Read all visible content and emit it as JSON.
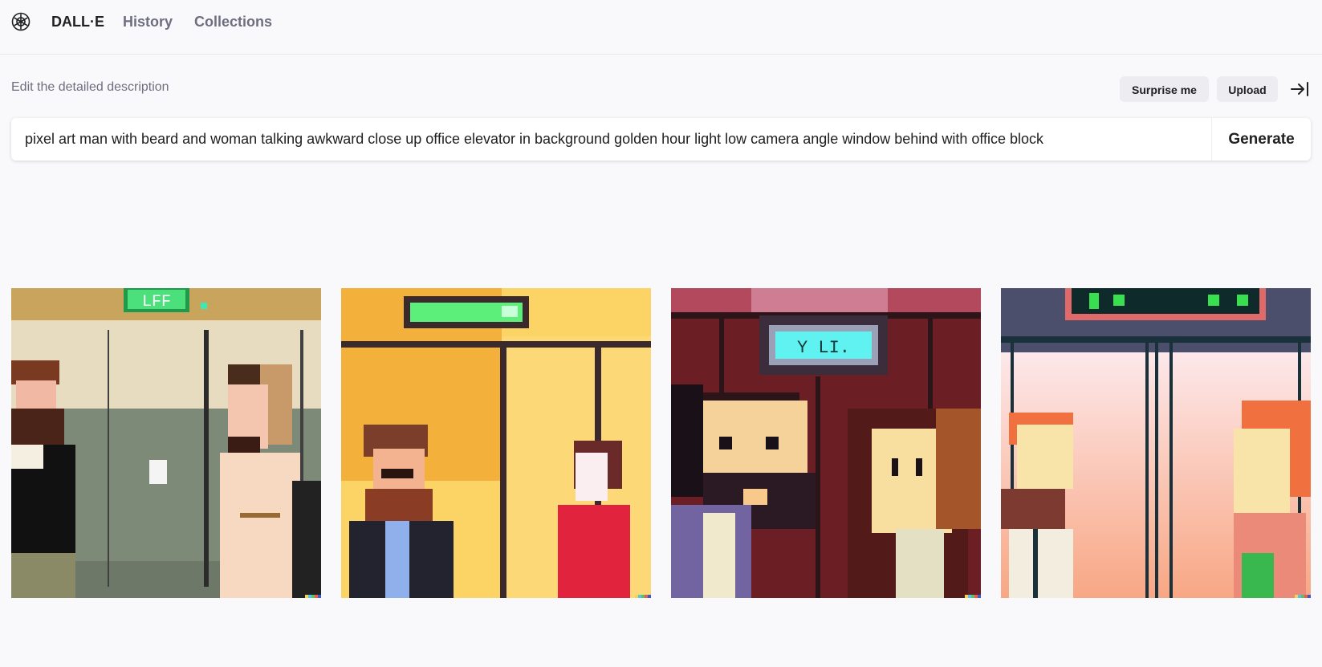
{
  "nav": {
    "brand": "DALL·E",
    "history": "History",
    "collections": "Collections"
  },
  "prompt": {
    "label": "Edit the detailed description",
    "value": "pixel art man with beard and woman talking awkward close up office elevator in background golden hour light low camera angle window behind with office block",
    "generate_label": "Generate"
  },
  "actions": {
    "surprise_label": "Surprise me",
    "upload_label": "Upload"
  },
  "icons": {
    "logo": "openai-logo-icon",
    "collapse": "arrow-right-to-line-icon"
  },
  "results": [
    {
      "scene": "realistic pixel elevator, green sign",
      "sign_text": "LFF"
    },
    {
      "scene": "yellow pixel elevator, green display"
    },
    {
      "scene": "dark red pixel elevator, cyan display",
      "sign_text": "Y LI."
    },
    {
      "scene": "pink pixel elevator, dark display"
    }
  ],
  "colors": {
    "background": "#f9f9fb",
    "text": "#202123",
    "muted": "#6e6e80",
    "pill": "#ececf1"
  }
}
